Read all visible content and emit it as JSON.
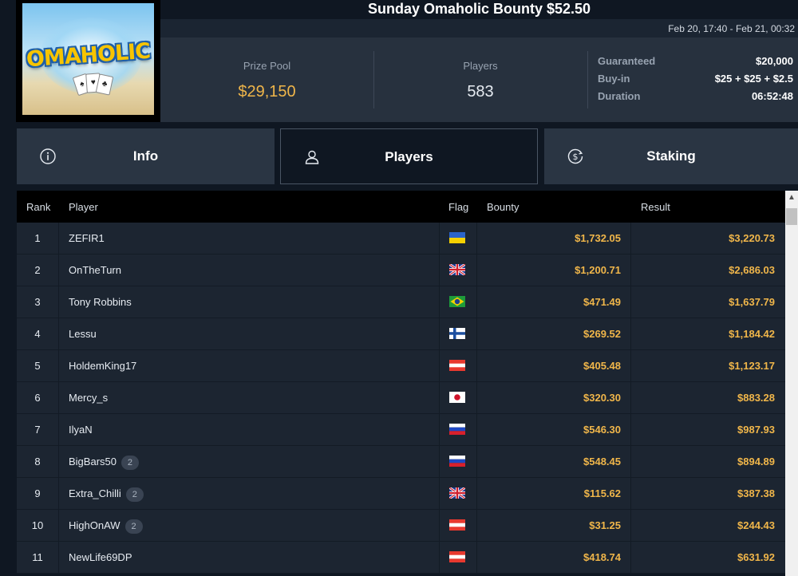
{
  "tournament": {
    "title": "Sunday Omaholic Bounty $52.50",
    "logo_text": "OMAHOLIC",
    "dates": "Feb 20, 17:40 - Feb 21, 00:32"
  },
  "stats": {
    "prize_pool_label": "Prize Pool",
    "prize_pool_value": "$29,150",
    "players_label": "Players",
    "players_value": "583",
    "guaranteed_label": "Guaranteed",
    "guaranteed_value": "$20,000",
    "buyin_label": "Buy-in",
    "buyin_value": "$25 + $25 + $2.5",
    "duration_label": "Duration",
    "duration_value": "06:52:48"
  },
  "tabs": [
    {
      "label": "Info",
      "icon": "info-icon"
    },
    {
      "label": "Players",
      "icon": "user-icon",
      "active": true
    },
    {
      "label": "Staking",
      "icon": "dollar-coin-icon"
    }
  ],
  "table": {
    "headers": {
      "rank": "Rank",
      "player": "Player",
      "flag": "Flag",
      "bounty": "Bounty",
      "result": "Result"
    },
    "rows": [
      {
        "rank": "1",
        "player": "ZEFIR1",
        "badge": "",
        "flag": "ukraine",
        "bounty": "$1,732.05",
        "result": "$3,220.73"
      },
      {
        "rank": "2",
        "player": "OnTheTurn",
        "badge": "",
        "flag": "united-kingdom",
        "bounty": "$1,200.71",
        "result": "$2,686.03"
      },
      {
        "rank": "3",
        "player": "Tony Robbins",
        "badge": "",
        "flag": "brazil",
        "bounty": "$471.49",
        "result": "$1,637.79"
      },
      {
        "rank": "4",
        "player": "Lessu",
        "badge": "",
        "flag": "finland",
        "bounty": "$269.52",
        "result": "$1,184.42"
      },
      {
        "rank": "5",
        "player": "HoldemKing17",
        "badge": "",
        "flag": "austria",
        "bounty": "$405.48",
        "result": "$1,123.17"
      },
      {
        "rank": "6",
        "player": "Mercy_s",
        "badge": "",
        "flag": "japan",
        "bounty": "$320.30",
        "result": "$883.28"
      },
      {
        "rank": "7",
        "player": "IlyaN",
        "badge": "",
        "flag": "russia",
        "bounty": "$546.30",
        "result": "$987.93"
      },
      {
        "rank": "8",
        "player": "BigBars50",
        "badge": "2",
        "flag": "russia",
        "bounty": "$548.45",
        "result": "$894.89"
      },
      {
        "rank": "9",
        "player": "Extra_Chilli",
        "badge": "2",
        "flag": "united-kingdom",
        "bounty": "$115.62",
        "result": "$387.38"
      },
      {
        "rank": "10",
        "player": "HighOnAW",
        "badge": "2",
        "flag": "austria",
        "bounty": "$31.25",
        "result": "$244.43"
      },
      {
        "rank": "11",
        "player": "NewLife69DP",
        "badge": "",
        "flag": "austria",
        "bounty": "$418.74",
        "result": "$631.92"
      }
    ]
  },
  "colors": {
    "accent_gold": "#f0b64a",
    "background": "#0f1722",
    "panel": "#27313e",
    "row": "#1c2531"
  }
}
